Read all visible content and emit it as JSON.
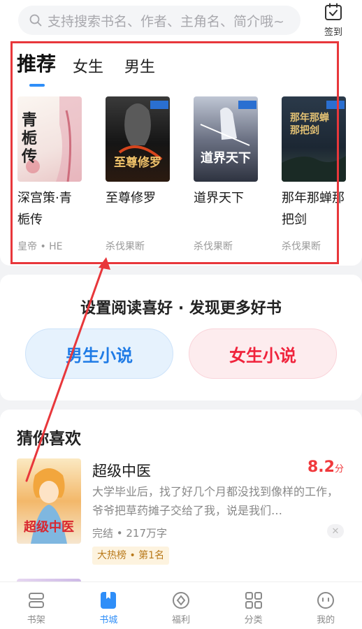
{
  "search": {
    "placeholder": "支持搜索书名、作者、主角名、简介哦~"
  },
  "signin": {
    "label": "签到"
  },
  "tabs": [
    {
      "label": "推荐"
    },
    {
      "label": "女生"
    },
    {
      "label": "男生"
    }
  ],
  "books": [
    {
      "title": "深宫策·青栀传",
      "author": "皇帝 • HE",
      "cover_text": "青栀传"
    },
    {
      "title": "至尊修罗",
      "author": "杀伐果断",
      "cover_text": "至尊修罗"
    },
    {
      "title": "道界天下",
      "author": "杀伐果断",
      "cover_text": "道界天下"
    },
    {
      "title": "那年那蝉那把剑",
      "author": "杀伐果断",
      "cover_text": "那年那蝉那把剑"
    }
  ],
  "preference": {
    "title": "设置阅读喜好 · 发现更多好书",
    "male_label": "男生小说",
    "female_label": "女生小说"
  },
  "guess": {
    "section_title": "猜你喜欢",
    "book_title": "超级中医",
    "score": "8.2",
    "score_unit": "分",
    "description": "大学毕业后，找了好几个月都没找到像样的工作，爷爷把草药摊子交给了我，说是我们…",
    "meta": "完结 • 217万字",
    "badge": "大热榜 • 第1名",
    "cover_text": "超级中医"
  },
  "nav": [
    {
      "label": "书架",
      "icon": "bookshelf-icon"
    },
    {
      "label": "书城",
      "icon": "bookstore-icon"
    },
    {
      "label": "福利",
      "icon": "welfare-icon"
    },
    {
      "label": "分类",
      "icon": "category-grid-icon"
    },
    {
      "label": "我的",
      "icon": "profile-face-icon"
    }
  ],
  "colors": {
    "accent": "#2f8ef8",
    "highlight": "#e8373b",
    "score": "#f0393c"
  }
}
